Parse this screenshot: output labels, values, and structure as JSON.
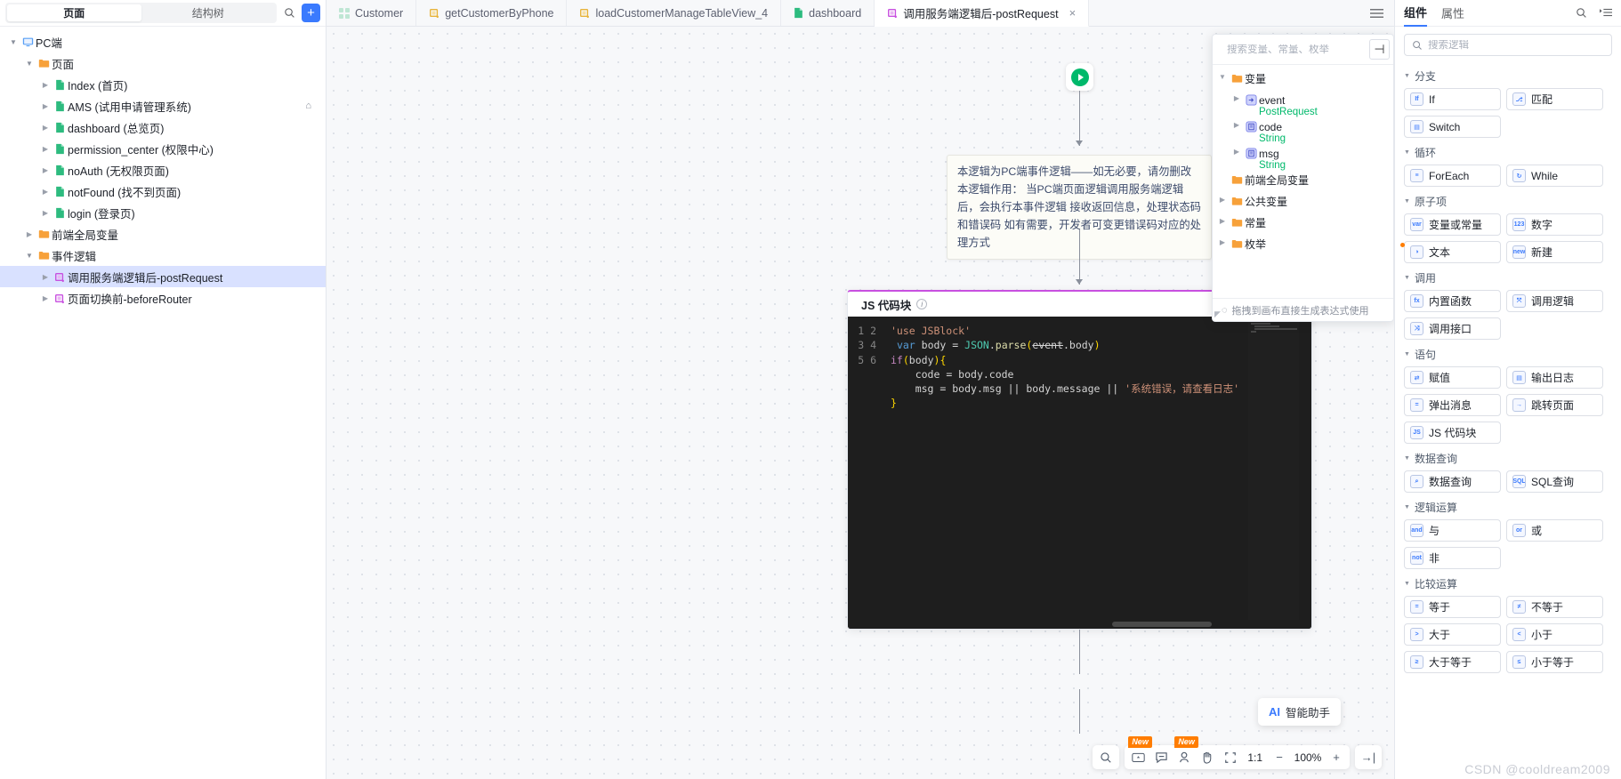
{
  "left_panel": {
    "tabs": [
      {
        "label": "页面",
        "active": true
      },
      {
        "label": "结构树",
        "active": false
      }
    ],
    "search_icon": "search-icon",
    "add_icon": "plus-icon",
    "tree": [
      {
        "label": "PC端",
        "indent": 0,
        "icon": "monitor-icon",
        "arrow": "open",
        "selected": false
      },
      {
        "label": "页面",
        "indent": 1,
        "icon": "folder-icon",
        "arrow": "open",
        "selected": false
      },
      {
        "label": "Index (首页)",
        "indent": 2,
        "icon": "page-icon",
        "arrow": "closed",
        "selected": false
      },
      {
        "label": "AMS (试用申请管理系统)",
        "indent": 2,
        "icon": "page-icon",
        "arrow": "closed",
        "selected": false,
        "home": true
      },
      {
        "label": "dashboard (总览页)",
        "indent": 2,
        "icon": "page-icon",
        "arrow": "closed",
        "selected": false
      },
      {
        "label": "permission_center (权限中心)",
        "indent": 2,
        "icon": "page-icon",
        "arrow": "closed",
        "selected": false
      },
      {
        "label": "noAuth (无权限页面)",
        "indent": 2,
        "icon": "page-icon",
        "arrow": "closed",
        "selected": false
      },
      {
        "label": "notFound (找不到页面)",
        "indent": 2,
        "icon": "page-icon",
        "arrow": "closed",
        "selected": false
      },
      {
        "label": "login (登录页)",
        "indent": 2,
        "icon": "page-icon",
        "arrow": "closed",
        "selected": false
      },
      {
        "label": "前端全局变量",
        "indent": 1,
        "icon": "folder-icon",
        "arrow": "closed",
        "selected": false
      },
      {
        "label": "事件逻辑",
        "indent": 1,
        "icon": "folder-icon",
        "arrow": "open",
        "selected": false
      },
      {
        "label": "调用服务端逻辑后-postRequest",
        "indent": 2,
        "icon": "logic-icon",
        "arrow": "closed",
        "selected": true
      },
      {
        "label": "页面切换前-beforeRouter",
        "indent": 2,
        "icon": "logic-icon",
        "arrow": "closed",
        "selected": false
      }
    ]
  },
  "tabs_bar": {
    "items": [
      {
        "label": "Customer",
        "icon": "grid-icon",
        "active": false,
        "closable": false
      },
      {
        "label": "getCustomerByPhone",
        "icon": "logic-yellow-icon",
        "active": false,
        "closable": false
      },
      {
        "label": "loadCustomerManageTableView_4",
        "icon": "logic-yellow-icon",
        "active": false,
        "closable": false
      },
      {
        "label": "dashboard",
        "icon": "page-icon",
        "active": false,
        "closable": false
      },
      {
        "label": "调用服务端逻辑后-postRequest",
        "icon": "logic-purple-icon",
        "active": true,
        "closable": true
      }
    ],
    "close_label": "×",
    "menu_icon": "list-menu-icon"
  },
  "canvas": {
    "start_node": {
      "icon": "play-icon"
    },
    "comment": {
      "text": "本逻辑为PC端事件逻辑——如无必要，请勿删改 本逻辑作用：  当PC端页面逻辑调用服务端逻辑后，会执行本事件逻辑 接收返回信息，处理状态码和错误码 如有需要，开发者可变更错误码对应的处理方式"
    },
    "js_block": {
      "title": "JS 代码块",
      "info_icon": "info-icon",
      "collapse_icon": "collapse-icon",
      "line_numbers": [
        "1",
        "2",
        "3",
        "4",
        "5",
        "6"
      ],
      "code_lines": [
        "'use JSBlock'",
        "var body = JSON.parse(event.body)",
        "if(body){",
        "    code = body.code",
        "    msg = body.msg || body.message || '系统错误，请查看日志'",
        "}"
      ]
    }
  },
  "var_panel": {
    "search_placeholder": "搜索变量、常量、枚举",
    "search_icon": "search-icon",
    "add_icon": "plus-icon",
    "items": [
      {
        "label": "变量",
        "type": "",
        "indent": 0,
        "icon": "folder-icon",
        "arrow": "open"
      },
      {
        "label": "event",
        "type": "PostRequest",
        "indent": 1,
        "icon": "object-var-icon",
        "arrow": "closed"
      },
      {
        "label": "code",
        "type": "String",
        "indent": 1,
        "icon": "string-var-icon",
        "arrow": "closed"
      },
      {
        "label": "msg",
        "type": "String",
        "indent": 1,
        "icon": "string-var-icon",
        "arrow": "closed"
      },
      {
        "label": "前端全局变量",
        "type": "",
        "indent": 0,
        "icon": "folder-icon",
        "arrow": "none"
      },
      {
        "label": "公共变量",
        "type": "",
        "indent": 0,
        "icon": "folder-icon",
        "arrow": "closed"
      },
      {
        "label": "常量",
        "type": "",
        "indent": 0,
        "icon": "folder-icon",
        "arrow": "closed"
      },
      {
        "label": "枚举",
        "type": "",
        "indent": 0,
        "icon": "folder-icon",
        "arrow": "closed"
      }
    ],
    "footer_hint": "拖拽到画布直接生成表达式使用",
    "footer_icon": "bulb-icon"
  },
  "bottom_bar": {
    "ai_button": {
      "mark": "AI",
      "label": "智能助手"
    },
    "buttons": [
      {
        "name": "search-icon",
        "glyph": "⌕",
        "badge": ""
      },
      {
        "name": "minimap-icon",
        "glyph": "▭",
        "badge": "New"
      },
      {
        "name": "comment-icon",
        "glyph": "🗨",
        "badge": ""
      },
      {
        "name": "locate-icon",
        "glyph": "◉",
        "badge": "New"
      },
      {
        "name": "hand-icon",
        "glyph": "✋",
        "badge": ""
      },
      {
        "name": "fit-icon",
        "glyph": "⤡",
        "badge": ""
      }
    ],
    "ratio_label": "1:1",
    "zoom_out": "−",
    "zoom_value": "100%",
    "zoom_in": "+",
    "expand_icon": "→|"
  },
  "right_panel": {
    "tabs": [
      {
        "label": "组件",
        "active": true
      },
      {
        "label": "属性",
        "active": false
      }
    ],
    "search_icon": "search-icon",
    "list_icon": "list-icon",
    "search_placeholder": "搜索逻辑",
    "groups": [
      {
        "title": "分支",
        "items": [
          {
            "label": "If",
            "icon": "if-icon"
          },
          {
            "label": "匹配",
            "icon": "match-icon"
          },
          {
            "label": "Switch",
            "icon": "switch-icon"
          }
        ]
      },
      {
        "title": "循环",
        "items": [
          {
            "label": "ForEach",
            "icon": "foreach-icon"
          },
          {
            "label": "While",
            "icon": "while-icon"
          }
        ]
      },
      {
        "title": "原子项",
        "items": [
          {
            "label": "变量或常量",
            "icon": "var-icon"
          },
          {
            "label": "数字",
            "icon": "number-icon"
          },
          {
            "label": "文本",
            "icon": "text-icon",
            "dot": true
          },
          {
            "label": "新建",
            "icon": "new-icon"
          }
        ]
      },
      {
        "title": "调用",
        "items": [
          {
            "label": "内置函数",
            "icon": "fx-icon"
          },
          {
            "label": "调用逻辑",
            "icon": "call-logic-icon"
          },
          {
            "label": "调用接口",
            "icon": "call-api-icon"
          }
        ]
      },
      {
        "title": "语句",
        "items": [
          {
            "label": "赋值",
            "icon": "assign-icon"
          },
          {
            "label": "输出日志",
            "icon": "log-icon"
          },
          {
            "label": "弹出消息",
            "icon": "message-icon"
          },
          {
            "label": "跳转页面",
            "icon": "navigate-icon"
          },
          {
            "label": "JS 代码块",
            "icon": "js-icon"
          }
        ]
      },
      {
        "title": "数据查询",
        "items": [
          {
            "label": "数据查询",
            "icon": "query-icon"
          },
          {
            "label": "SQL查询",
            "icon": "sql-icon"
          }
        ]
      },
      {
        "title": "逻辑运算",
        "items": [
          {
            "label": "与",
            "icon": "and-icon"
          },
          {
            "label": "或",
            "icon": "or-icon"
          },
          {
            "label": "非",
            "icon": "not-icon"
          }
        ]
      },
      {
        "title": "比较运算",
        "items": [
          {
            "label": "等于",
            "icon": "eq-icon"
          },
          {
            "label": "不等于",
            "icon": "neq-icon"
          },
          {
            "label": "大于",
            "icon": "gt-icon"
          },
          {
            "label": "小于",
            "icon": "lt-icon"
          },
          {
            "label": "大于等于",
            "icon": "gte-icon"
          },
          {
            "label": "小于等于",
            "icon": "lte-icon"
          }
        ]
      }
    ]
  },
  "watermark": "CSDN @cooldream2009"
}
